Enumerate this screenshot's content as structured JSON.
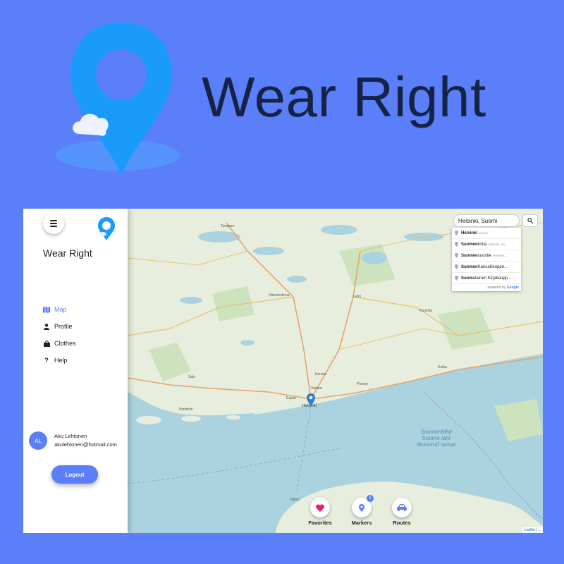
{
  "hero": {
    "title": "Wear Right"
  },
  "sidebar": {
    "title": "Wear Right",
    "nav": [
      {
        "label": "Map",
        "icon": "map-icon",
        "active": true
      },
      {
        "label": "Profile",
        "icon": "user-icon",
        "active": false
      },
      {
        "label": "Clothes",
        "icon": "bag-icon",
        "active": false
      },
      {
        "label": "Help",
        "icon": "question-icon",
        "active": false
      }
    ],
    "user": {
      "initials": "AL",
      "name": "Aku Lehtonen",
      "email": "akulehtonen@hotmail.com"
    },
    "logout_label": "Logout"
  },
  "search": {
    "value": "Helsinki, Suomi",
    "suggestions": [
      {
        "bold": "Helsinki",
        "rest": "",
        "secondary": "Suomi"
      },
      {
        "bold": "Suomen",
        "rest": "linna",
        "secondary": "Helsinki, Su..."
      },
      {
        "bold": "Suomen",
        "rest": "suontie",
        "secondary": "Helsinki, ..."
      },
      {
        "bold": "Suomen",
        "rest": " Kansallisoppe...",
        "secondary": ""
      },
      {
        "bold": "Suom",
        "rest": "alainen Kirjakaupp...",
        "secondary": ""
      }
    ],
    "powered_by": "powered by",
    "powered_brand": "Google"
  },
  "map": {
    "places": {
      "tampere": "Tampere",
      "hameenlinna": "Hämeenlinna",
      "lahti": "Lahti",
      "kouvola": "Kouvola",
      "kotka": "Kotka",
      "porvoo": "Porvoo",
      "kerava": "Kerava",
      "vantaa": "Vantaa",
      "espoo": "Espoo",
      "helsinki": "Helsinki",
      "salo": "Salo",
      "kimito": "Kimitoön",
      "tallinn": "Tallinn"
    },
    "sea": {
      "line1": "Suomenlahti",
      "line2": "Soome laht",
      "line3": "Финский залив"
    }
  },
  "actions": [
    {
      "label": "Favorites",
      "icon": "heart-icon"
    },
    {
      "label": "Markers",
      "icon": "marker-icon",
      "badge": "1"
    },
    {
      "label": "Routes",
      "icon": "car-icon"
    }
  ],
  "attribution": "Leaflet | ...",
  "colors": {
    "background": "#5b7ef9",
    "accent": "#5b7ef9",
    "logo_blue": "#1a9bfc",
    "title_dark": "#142346",
    "heart": "#e91e63",
    "sea": "#aad3df",
    "land": "#e8eedd"
  }
}
